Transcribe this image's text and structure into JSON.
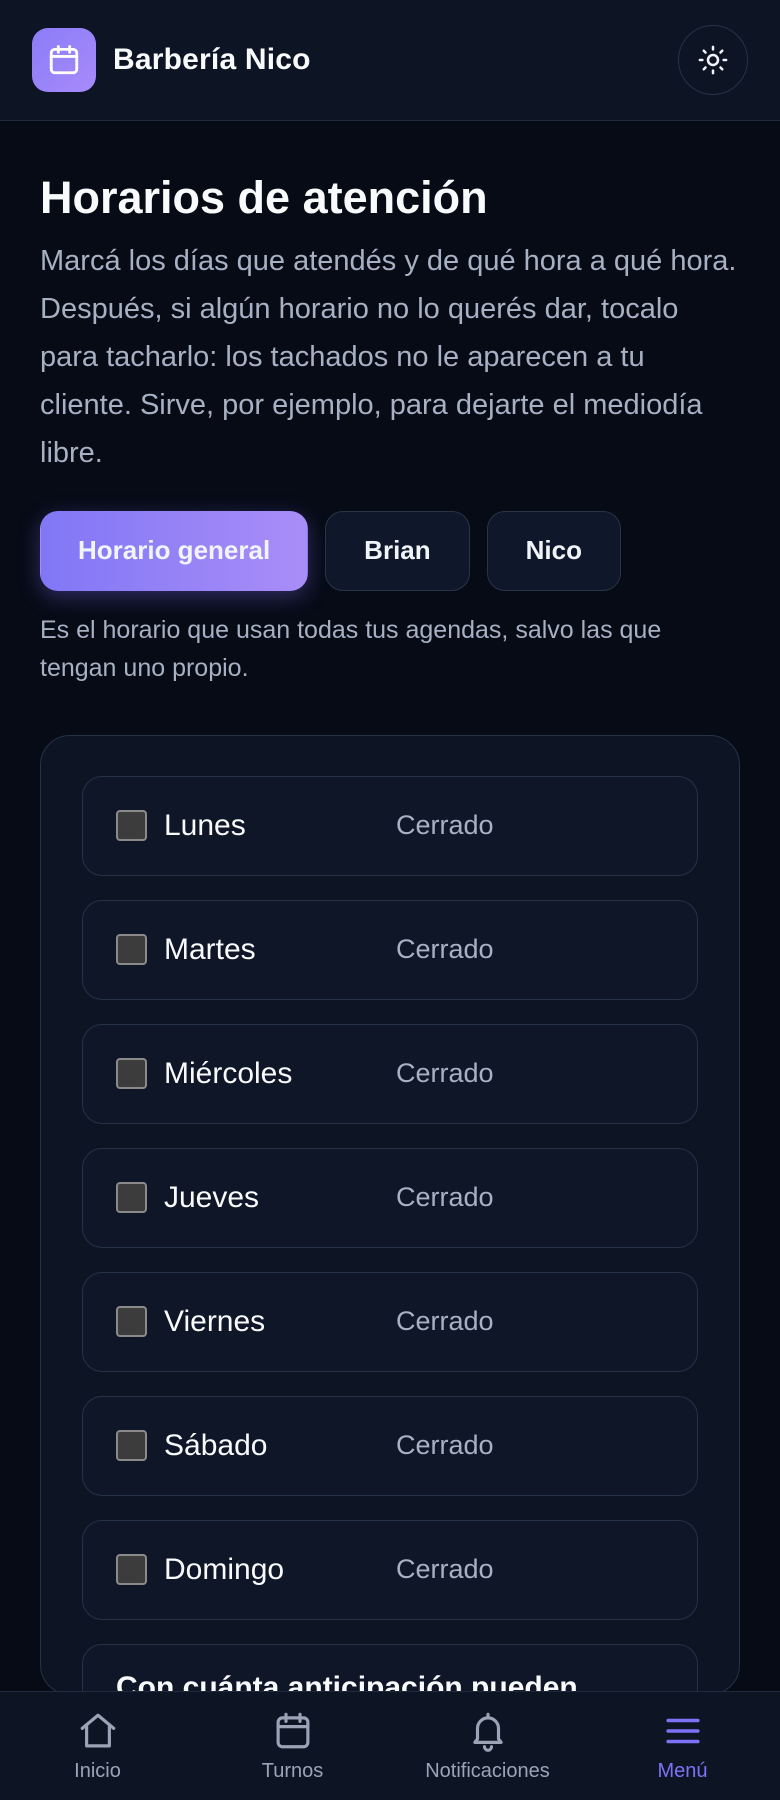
{
  "header": {
    "brand_name": "Barbería Nico",
    "logo_icon": "calendar-icon",
    "theme_toggle_icon": "sun-icon"
  },
  "page": {
    "title": "Horarios de atención",
    "description": "Marcá los días que atendés y de qué hora a qué hora. Después, si algún horario no lo querés dar, tocalo para tacharlo: los tachados no le aparecen a tu cliente. Sirve, por ejemplo, para dejarte el mediodía libre."
  },
  "tabs": [
    {
      "label": "Horario general",
      "active": true
    },
    {
      "label": "Brian",
      "active": false
    },
    {
      "label": "Nico",
      "active": false
    }
  ],
  "tab_hint": "Es el horario que usan todas tus agendas, salvo las que tengan uno propio.",
  "days": [
    {
      "name": "Lunes",
      "status": "Cerrado",
      "checked": false
    },
    {
      "name": "Martes",
      "status": "Cerrado",
      "checked": false
    },
    {
      "name": "Miércoles",
      "status": "Cerrado",
      "checked": false
    },
    {
      "name": "Jueves",
      "status": "Cerrado",
      "checked": false
    },
    {
      "name": "Viernes",
      "status": "Cerrado",
      "checked": false
    },
    {
      "name": "Sábado",
      "status": "Cerrado",
      "checked": false
    },
    {
      "name": "Domingo",
      "status": "Cerrado",
      "checked": false
    }
  ],
  "extra_row_label": "Con cuánta anticipación pueden",
  "bottom_nav": [
    {
      "label": "Inicio",
      "icon": "home-icon",
      "active": false
    },
    {
      "label": "Turnos",
      "icon": "calendar-icon",
      "active": false
    },
    {
      "label": "Notificaciones",
      "icon": "bell-icon",
      "active": false
    },
    {
      "label": "Menú",
      "icon": "menu-icon",
      "active": true
    }
  ],
  "colors": {
    "accent": "#8177f6",
    "accent_end": "#a98df7",
    "background": "#060b16",
    "surface": "#0d1525"
  }
}
